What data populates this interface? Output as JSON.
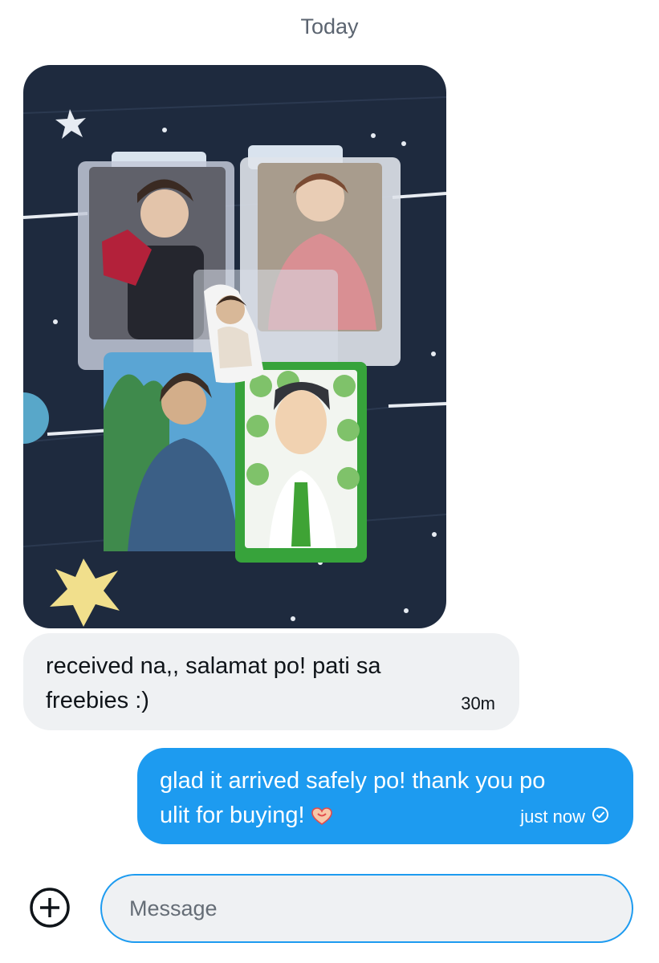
{
  "conversation": {
    "date_separator": "Today"
  },
  "messages": [
    {
      "direction": "incoming",
      "type": "image",
      "alt": "Photo of photocards in sleeves and a frog-themed card on a starry blanket"
    },
    {
      "direction": "incoming",
      "type": "text",
      "text": "received na,, salamat po! pati sa freebies :)",
      "time": "30m"
    },
    {
      "direction": "outgoing",
      "type": "text",
      "text": "glad it arrived safely po! thank you po ulit for buying!",
      "emoji": "heart-hands-emoji",
      "time": "just now",
      "status_icon": "seen-check-icon"
    }
  ],
  "composer": {
    "placeholder": "Message",
    "add_icon": "plus-circle-icon"
  },
  "colors": {
    "accent": "#1d9bf0",
    "incoming_bubble": "#eff1f3",
    "text": "#0f1419",
    "muted": "#5b6470"
  }
}
